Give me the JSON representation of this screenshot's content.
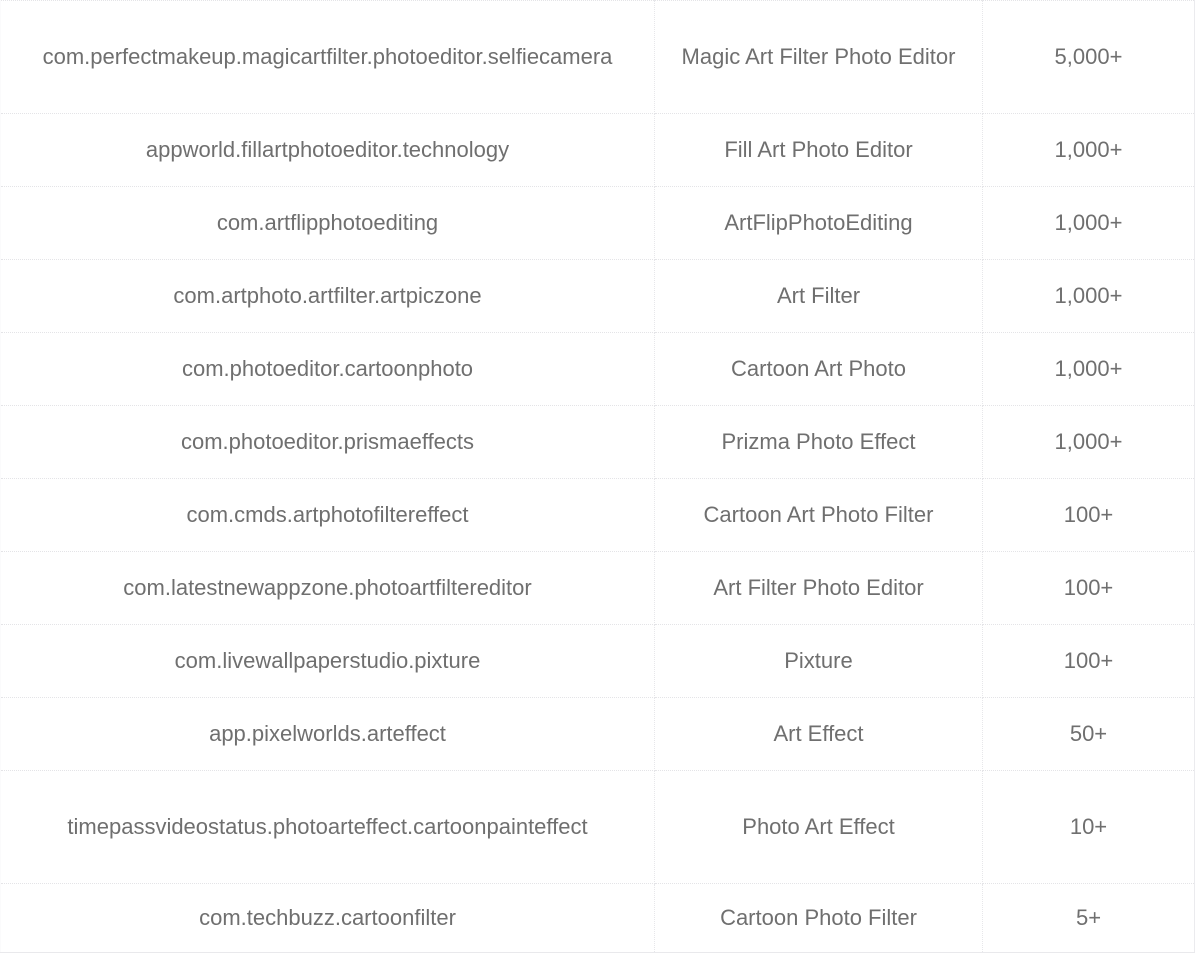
{
  "table": {
    "columns": [
      {
        "key": "package",
        "name": "package-name-column"
      },
      {
        "key": "title",
        "name": "app-title-column"
      },
      {
        "key": "installs",
        "name": "installs-column"
      }
    ],
    "rows": [
      {
        "package": "com.perfectmakeup.magicartfilter.photoeditor.selfiecamera",
        "title": "Magic Art Filter Photo Editor",
        "installs": "5,000+"
      },
      {
        "package": "appworld.fillartphotoeditor.technology",
        "title": "Fill Art Photo Editor",
        "installs": "1,000+"
      },
      {
        "package": "com.artflipphotoediting",
        "title": "ArtFlipPhotoEditing",
        "installs": "1,000+"
      },
      {
        "package": "com.artphoto.artfilter.artpiczone",
        "title": "Art Filter",
        "installs": "1,000+"
      },
      {
        "package": "com.photoeditor.cartoonphoto",
        "title": "Cartoon Art Photo",
        "installs": "1,000+"
      },
      {
        "package": "com.photoeditor.prismaeffects",
        "title": "Prizma Photo Effect",
        "installs": "1,000+"
      },
      {
        "package": "com.cmds.artphotofiltereffect",
        "title": "Cartoon Art Photo Filter",
        "installs": "100+"
      },
      {
        "package": "com.latestnewappzone.photoartfiltereditor",
        "title": "Art Filter Photo Editor",
        "installs": "100+"
      },
      {
        "package": "com.livewallpaperstudio.pixture",
        "title": "Pixture",
        "installs": "100+"
      },
      {
        "package": "app.pixelworlds.arteffect",
        "title": "Art Effect",
        "installs": "50+"
      },
      {
        "package": "timepassvideostatus.photoarteffect.cartoonpainteffect",
        "title": "Photo Art Effect",
        "installs": "10+"
      },
      {
        "package": "com.techbuzz.cartoonfilter",
        "title": "Cartoon Photo Filter",
        "installs": "5+"
      }
    ]
  },
  "colors": {
    "text": "#6f6f6f",
    "grid_dotted": "#e4e4e7",
    "grid_solid": "#e9e9ec",
    "background": "#ffffff"
  }
}
